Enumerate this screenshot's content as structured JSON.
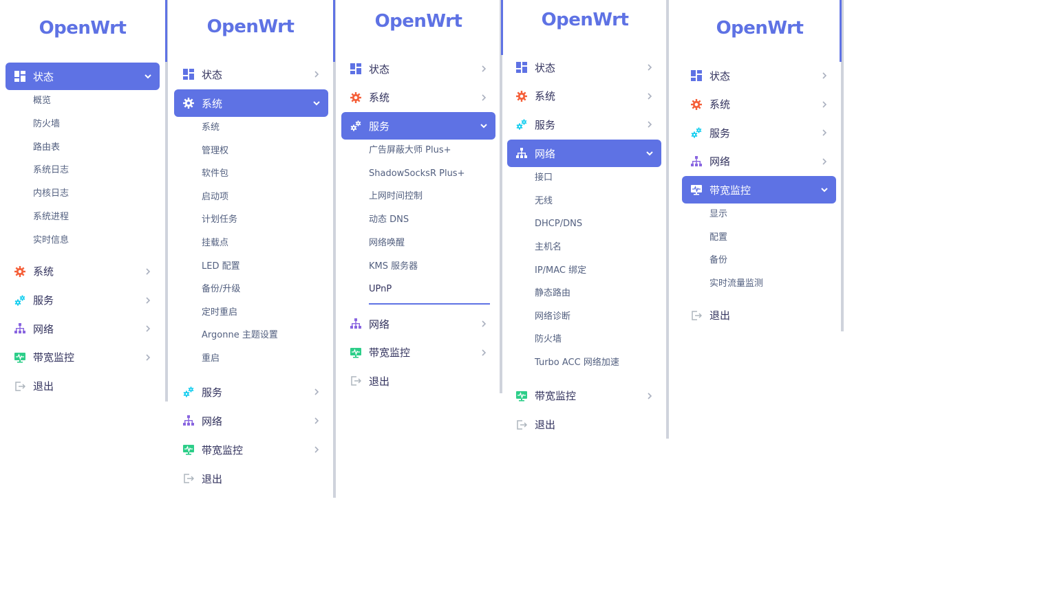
{
  "brand": "OpenWrt",
  "colors": {
    "accent": "#5e72e4",
    "orange": "#f5603a",
    "teal": "#11cdef",
    "purple": "#8965e0",
    "green": "#2dce89",
    "gray": "#adb5bd"
  },
  "menu": {
    "status": "状态",
    "system": "系统",
    "services": "服务",
    "network": "网络",
    "bandwidth": "带宽监控",
    "logout": "退出"
  },
  "panels": [
    {
      "expanded": "status",
      "sub": [
        "概览",
        "防火墙",
        "路由表",
        "系统日志",
        "内核日志",
        "系统进程",
        "实时信息"
      ]
    },
    {
      "expanded": "system",
      "sub": [
        "系统",
        "管理权",
        "软件包",
        "启动项",
        "计划任务",
        "挂载点",
        "LED 配置",
        "备份/升级",
        "定时重启",
        "Argonne 主题设置",
        "重启"
      ]
    },
    {
      "expanded": "services",
      "sub": [
        "广告屏蔽大师 Plus+",
        "ShadowSocksR Plus+",
        "上网时间控制",
        "动态 DNS",
        "网络唤醒",
        "KMS 服务器",
        "UPnP"
      ],
      "highlighted": "UPnP"
    },
    {
      "expanded": "network",
      "sub": [
        "接口",
        "无线",
        "DHCP/DNS",
        "主机名",
        "IP/MAC 绑定",
        "静态路由",
        "网络诊断",
        "防火墙",
        "Turbo ACC 网络加速"
      ]
    },
    {
      "expanded": "bandwidth",
      "sub": [
        "显示",
        "配置",
        "备份",
        "实时流量监测"
      ]
    }
  ]
}
